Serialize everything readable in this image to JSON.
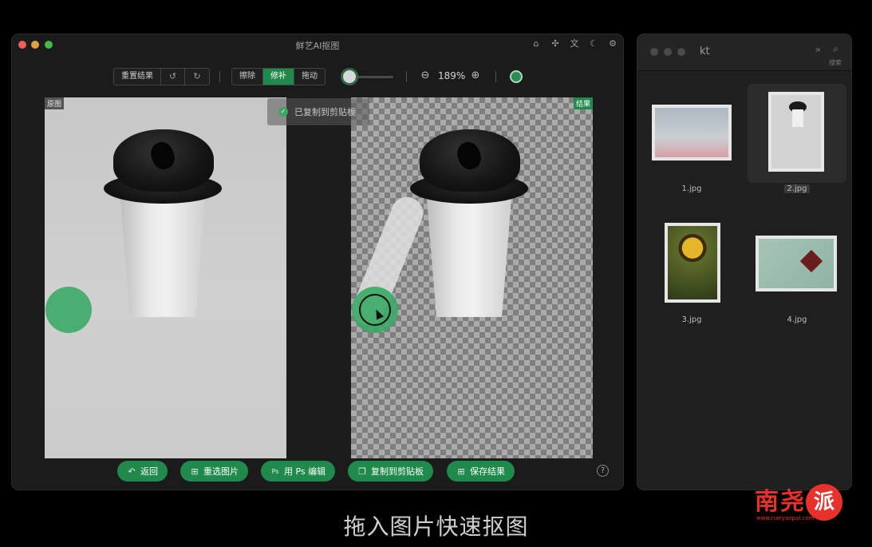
{
  "main_window": {
    "title": "鲜艺AI抠图",
    "title_icons": [
      "home-icon",
      "puzzle-icon",
      "translate-icon",
      "moon-icon",
      "gear-icon"
    ]
  },
  "toolbar": {
    "reset_label": "重置结果",
    "undo_icon": "undo-icon",
    "redo_icon": "redo-icon",
    "modes": [
      {
        "label": "擦除",
        "active": false
      },
      {
        "label": "修补",
        "active": true
      },
      {
        "label": "拖动",
        "active": false
      }
    ],
    "brush_size_fraction": 0.05,
    "zoom_level": "189%"
  },
  "panels": {
    "original_tag": "原图",
    "result_tag": "结果"
  },
  "toast": {
    "text": "已复制到剪贴板"
  },
  "actions": [
    {
      "name": "back-button",
      "icon": "↶",
      "label": "返回"
    },
    {
      "name": "reselect-image-button",
      "icon": "⊞",
      "label": "重选图片"
    },
    {
      "name": "edit-in-ps-button",
      "icon": "Ps",
      "label": "用 Ps 编辑"
    },
    {
      "name": "copy-to-clipboard-button",
      "icon": "❐",
      "label": "复制到剪贴板"
    },
    {
      "name": "save-result-button",
      "icon": "⊞",
      "label": "保存结果"
    }
  ],
  "help_icon": "?",
  "finder": {
    "title": "kt",
    "search_label": "搜索",
    "files": [
      {
        "name": "1.jpg",
        "selected": false
      },
      {
        "name": "2.jpg",
        "selected": true
      },
      {
        "name": "3.jpg",
        "selected": false
      },
      {
        "name": "4.jpg",
        "selected": false
      }
    ]
  },
  "caption": "拖入图片快速抠图",
  "watermark": {
    "chars": [
      "南",
      "尧",
      "派"
    ],
    "url": "www.nanyaopai.com"
  },
  "colors": {
    "accent": "#1f8a4c",
    "brush": "#3aaa64",
    "logo": "#e8312a"
  }
}
